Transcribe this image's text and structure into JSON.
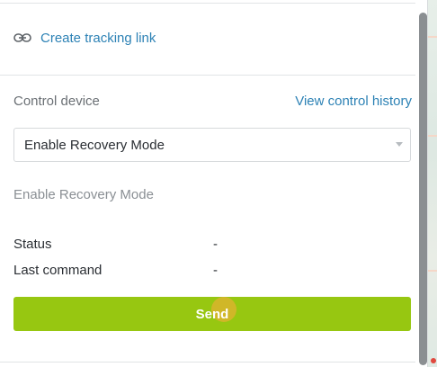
{
  "tracking": {
    "icon": "link-icon",
    "label": "Create tracking link"
  },
  "control": {
    "label": "Control device",
    "history_link": "View control history",
    "select": {
      "value": "Enable Recovery Mode"
    },
    "description": "Enable Recovery Mode"
  },
  "info": {
    "status_label": "Status",
    "status_value": "-",
    "last_command_label": "Last command",
    "last_command_value": "-"
  },
  "send_button": {
    "label": "Send",
    "color": "#97c711"
  },
  "colors": {
    "link": "#2d82b5",
    "muted": "#6b7075",
    "text": "#2a2e33"
  }
}
